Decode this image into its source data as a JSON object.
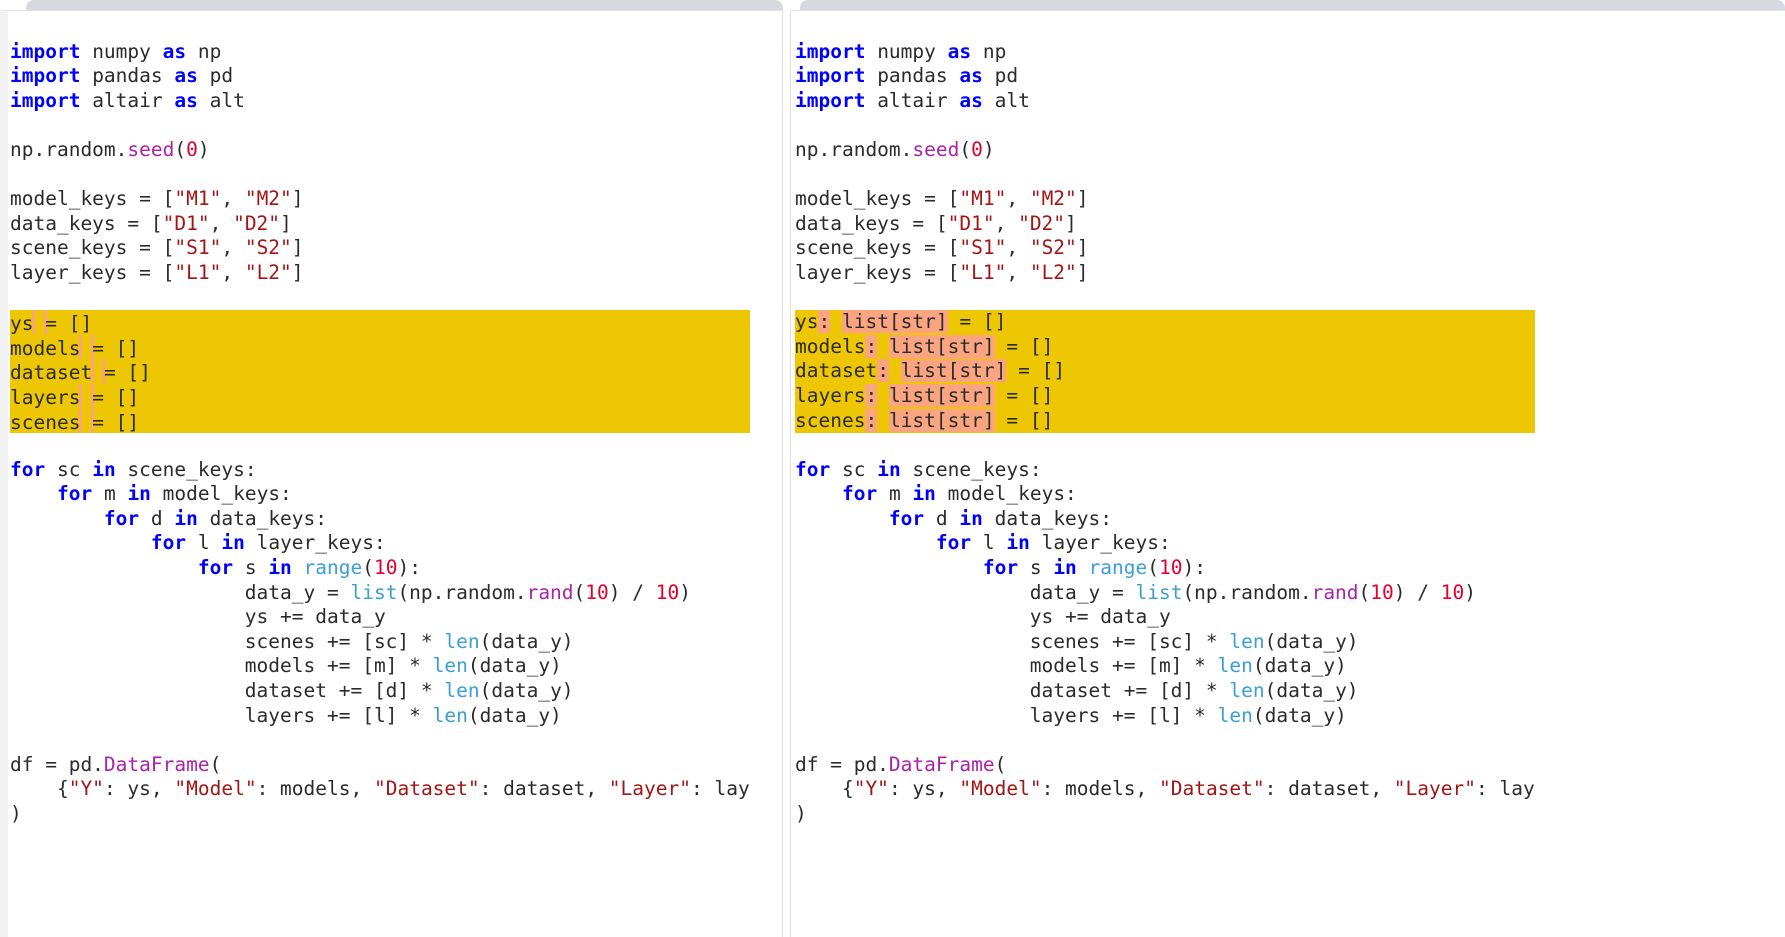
{
  "view": {
    "kind": "side-by-side-code-diff",
    "language": "python",
    "colors": {
      "changed_line_background": "#edc703",
      "inserted_token_background": "#faa580",
      "keyword": "#0000ff",
      "builtin": "#3b9ed6",
      "call": "#aa22aa",
      "number": "#e4002b",
      "string": "#a31515",
      "text": "#2b2b2b",
      "pane_background": "#ffffff",
      "chrome": "#d6dae0"
    }
  },
  "panes": {
    "left": {
      "name": "original",
      "lines": [
        "import numpy as np",
        "import pandas as pd",
        "import altair as alt",
        "",
        "np.random.seed(0)",
        "",
        "model_keys = [\"M1\", \"M2\"]",
        "data_keys = [\"D1\", \"D2\"]",
        "scene_keys = [\"S1\", \"S2\"]",
        "layer_keys = [\"L1\", \"L2\"]",
        "",
        "ys = []",
        "models = []",
        "dataset = []",
        "layers = []",
        "scenes = []",
        "",
        "for sc in scene_keys:",
        "    for m in model_keys:",
        "        for d in data_keys:",
        "            for l in layer_keys:",
        "                for s in range(10):",
        "                    data_y = list(np.random.rand(10) / 10)",
        "                    ys += data_y",
        "                    scenes += [sc] * len(data_y)",
        "                    models += [m] * len(data_y)",
        "                    dataset += [d] * len(data_y)",
        "                    layers += [l] * len(data_y)",
        "",
        "df = pd.DataFrame(",
        "    {\"Y\": ys, \"Model\": models, \"Dataset\": dataset, \"Layer\": lay",
        ")"
      ],
      "highlighted_line_indexes": [
        11,
        12,
        13,
        14,
        15
      ]
    },
    "right": {
      "name": "modified",
      "lines": [
        "import numpy as np",
        "import pandas as pd",
        "import altair as alt",
        "",
        "np.random.seed(0)",
        "",
        "model_keys = [\"M1\", \"M2\"]",
        "data_keys = [\"D1\", \"D2\"]",
        "scene_keys = [\"S1\", \"S2\"]",
        "layer_keys = [\"L1\", \"L2\"]",
        "",
        "ys: list[str] = []",
        "models: list[str] = []",
        "dataset: list[str] = []",
        "layers: list[str] = []",
        "scenes: list[str] = []",
        "",
        "for sc in scene_keys:",
        "    for m in model_keys:",
        "        for d in data_keys:",
        "            for l in layer_keys:",
        "                for s in range(10):",
        "                    data_y = list(np.random.rand(10) / 10)",
        "                    ys += data_y",
        "                    scenes += [sc] * len(data_y)",
        "                    models += [m] * len(data_y)",
        "                    dataset += [d] * len(data_y)",
        "                    layers += [l] * len(data_y)",
        "",
        "df = pd.DataFrame(",
        "    {\"Y\": ys, \"Model\": models, \"Dataset\": dataset, \"Layer\": lay",
        ")"
      ],
      "highlighted_line_indexes": [
        11,
        12,
        13,
        14,
        15
      ],
      "inserted_tokens": [
        ": list[str]",
        ": list[str]",
        ": list[str]",
        ": list[str]",
        ": list[str]"
      ]
    }
  }
}
